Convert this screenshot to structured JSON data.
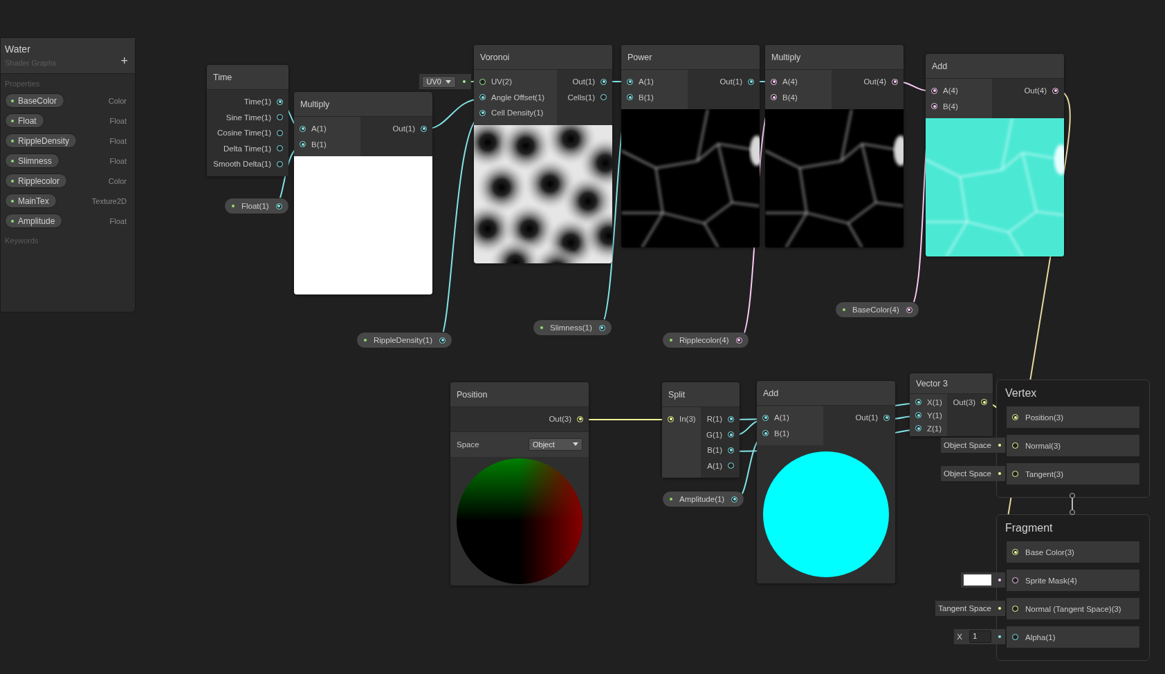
{
  "blackboard": {
    "title": "Water",
    "subtitle": "Shader Graphs",
    "add_button": "+",
    "properties_label": "Properties",
    "keywords_label": "Keywords",
    "properties": [
      {
        "name": "BaseColor",
        "type": "Color"
      },
      {
        "name": "Float",
        "type": "Float"
      },
      {
        "name": "RippleDensity",
        "type": "Float"
      },
      {
        "name": "Slimness",
        "type": "Float"
      },
      {
        "name": "Ripplecolor",
        "type": "Color"
      },
      {
        "name": "MainTex",
        "type": "Texture2D"
      },
      {
        "name": "Amplitude",
        "type": "Float"
      }
    ]
  },
  "nodes": [
    {
      "title": "Time",
      "outputs": [
        {
          "label": "Time(1)",
          "kind": "float",
          "connected": true
        },
        {
          "label": "Sine Time(1)",
          "kind": "float",
          "connected": false
        },
        {
          "label": "Cosine Time(1)",
          "kind": "float",
          "connected": false
        },
        {
          "label": "Delta Time(1)",
          "kind": "float",
          "connected": false
        },
        {
          "label": "Smooth Delta(1)",
          "kind": "float",
          "connected": false
        }
      ]
    },
    {
      "title": "Multiply",
      "inputs": [
        {
          "label": "A(1)",
          "kind": "float",
          "connected": true
        },
        {
          "label": "B(1)",
          "kind": "float",
          "connected": true
        }
      ],
      "outputs": [
        {
          "label": "Out(1)",
          "kind": "float",
          "connected": true
        }
      ],
      "preview": {
        "kind": "white"
      }
    },
    {
      "title": "Voronoi",
      "inputs": [
        {
          "label": "UV(2)",
          "kind": "vector2",
          "connected": false,
          "inline": {
            "kind": "dropdown",
            "value": "UV0"
          }
        },
        {
          "label": "Angle Offset(1)",
          "kind": "float",
          "connected": true
        },
        {
          "label": "Cell Density(1)",
          "kind": "float",
          "connected": true
        }
      ],
      "outputs": [
        {
          "label": "Out(1)",
          "kind": "float",
          "connected": true
        },
        {
          "label": "Cells(1)",
          "kind": "float",
          "connected": false
        }
      ],
      "preview": {
        "kind": "voronoi"
      }
    },
    {
      "title": "Power",
      "inputs": [
        {
          "label": "A(1)",
          "kind": "float",
          "connected": true
        },
        {
          "label": "B(1)",
          "kind": "float",
          "connected": true
        }
      ],
      "outputs": [
        {
          "label": "Out(1)",
          "kind": "float",
          "connected": true
        }
      ],
      "preview": {
        "kind": "glow"
      }
    },
    {
      "title": "Multiply",
      "inputs": [
        {
          "label": "A(4)",
          "kind": "vector4",
          "connected": true
        },
        {
          "label": "B(4)",
          "kind": "vector4",
          "connected": true
        }
      ],
      "outputs": [
        {
          "label": "Out(4)",
          "kind": "vector4",
          "connected": true
        }
      ],
      "preview": {
        "kind": "glow"
      }
    },
    {
      "title": "Add",
      "inputs": [
        {
          "label": "A(4)",
          "kind": "vector4",
          "connected": true
        },
        {
          "label": "B(4)",
          "kind": "vector4",
          "connected": true
        }
      ],
      "outputs": [
        {
          "label": "Out(4)",
          "kind": "vector4",
          "connected": true
        }
      ],
      "preview": {
        "kind": "water"
      }
    },
    {
      "title": "Position",
      "outputs": [
        {
          "label": "Out(3)",
          "kind": "vector3",
          "connected": true
        }
      ],
      "controls": [
        {
          "label": "Space",
          "value": "Object"
        }
      ],
      "preview": {
        "kind": "position_sphere"
      }
    },
    {
      "title": "Split",
      "inputs": [
        {
          "label": "In(3)",
          "kind": "vector3",
          "connected": true
        }
      ],
      "outputs": [
        {
          "label": "R(1)",
          "kind": "float",
          "connected": true
        },
        {
          "label": "G(1)",
          "kind": "float",
          "connected": true
        },
        {
          "label": "B(1)",
          "kind": "float",
          "connected": true
        },
        {
          "label": "A(1)",
          "kind": "float",
          "connected": false
        }
      ]
    },
    {
      "title": "Add",
      "inputs": [
        {
          "label": "A(1)",
          "kind": "float",
          "connected": true
        },
        {
          "label": "B(1)",
          "kind": "float",
          "connected": true
        }
      ],
      "outputs": [
        {
          "label": "Out(1)",
          "kind": "float",
          "connected": true
        }
      ],
      "preview": {
        "kind": "cyan_sphere"
      }
    },
    {
      "title": "Vector 3",
      "inputs": [
        {
          "label": "X(1)",
          "kind": "float",
          "connected": true
        },
        {
          "label": "Y(1)",
          "kind": "float",
          "connected": true
        },
        {
          "label": "Z(1)",
          "kind": "float",
          "connected": true
        }
      ],
      "outputs": [
        {
          "label": "Out(3)",
          "kind": "vector3",
          "connected": true
        }
      ]
    }
  ],
  "property_nodes": [
    {
      "label": "Float(1)",
      "kind": "float"
    },
    {
      "label": "RippleDensity(1)",
      "kind": "float"
    },
    {
      "label": "Slimness(1)",
      "kind": "float"
    },
    {
      "label": "Ripplecolor(4)",
      "kind": "vector4"
    },
    {
      "label": "BaseColor(4)",
      "kind": "vector4"
    },
    {
      "label": "Amplitude(1)",
      "kind": "float"
    }
  ],
  "contexts": [
    {
      "title": "Vertex",
      "blocks": [
        {
          "label": "Position(3)",
          "kind": "vector3",
          "connected": true
        },
        {
          "label": "Normal(3)",
          "kind": "vector3",
          "connected": false,
          "inline": {
            "kind": "text",
            "value": "Object Space"
          }
        },
        {
          "label": "Tangent(3)",
          "kind": "vector3",
          "connected": false,
          "inline": {
            "kind": "text",
            "value": "Object Space"
          }
        }
      ]
    },
    {
      "title": "Fragment",
      "blocks": [
        {
          "label": "Base Color(3)",
          "kind": "vector3",
          "connected": true
        },
        {
          "label": "Sprite Mask(4)",
          "kind": "vector4",
          "connected": false,
          "inline": {
            "kind": "swatch",
            "color": "#ffffff"
          }
        },
        {
          "label": "Normal (Tangent Space)(3)",
          "kind": "vector3",
          "connected": false,
          "inline": {
            "kind": "text",
            "value": "Tangent Space"
          }
        },
        {
          "label": "Alpha(1)",
          "kind": "float",
          "connected": false,
          "inline": {
            "kind": "number",
            "axis": "X",
            "value": "1"
          }
        }
      ]
    }
  ]
}
